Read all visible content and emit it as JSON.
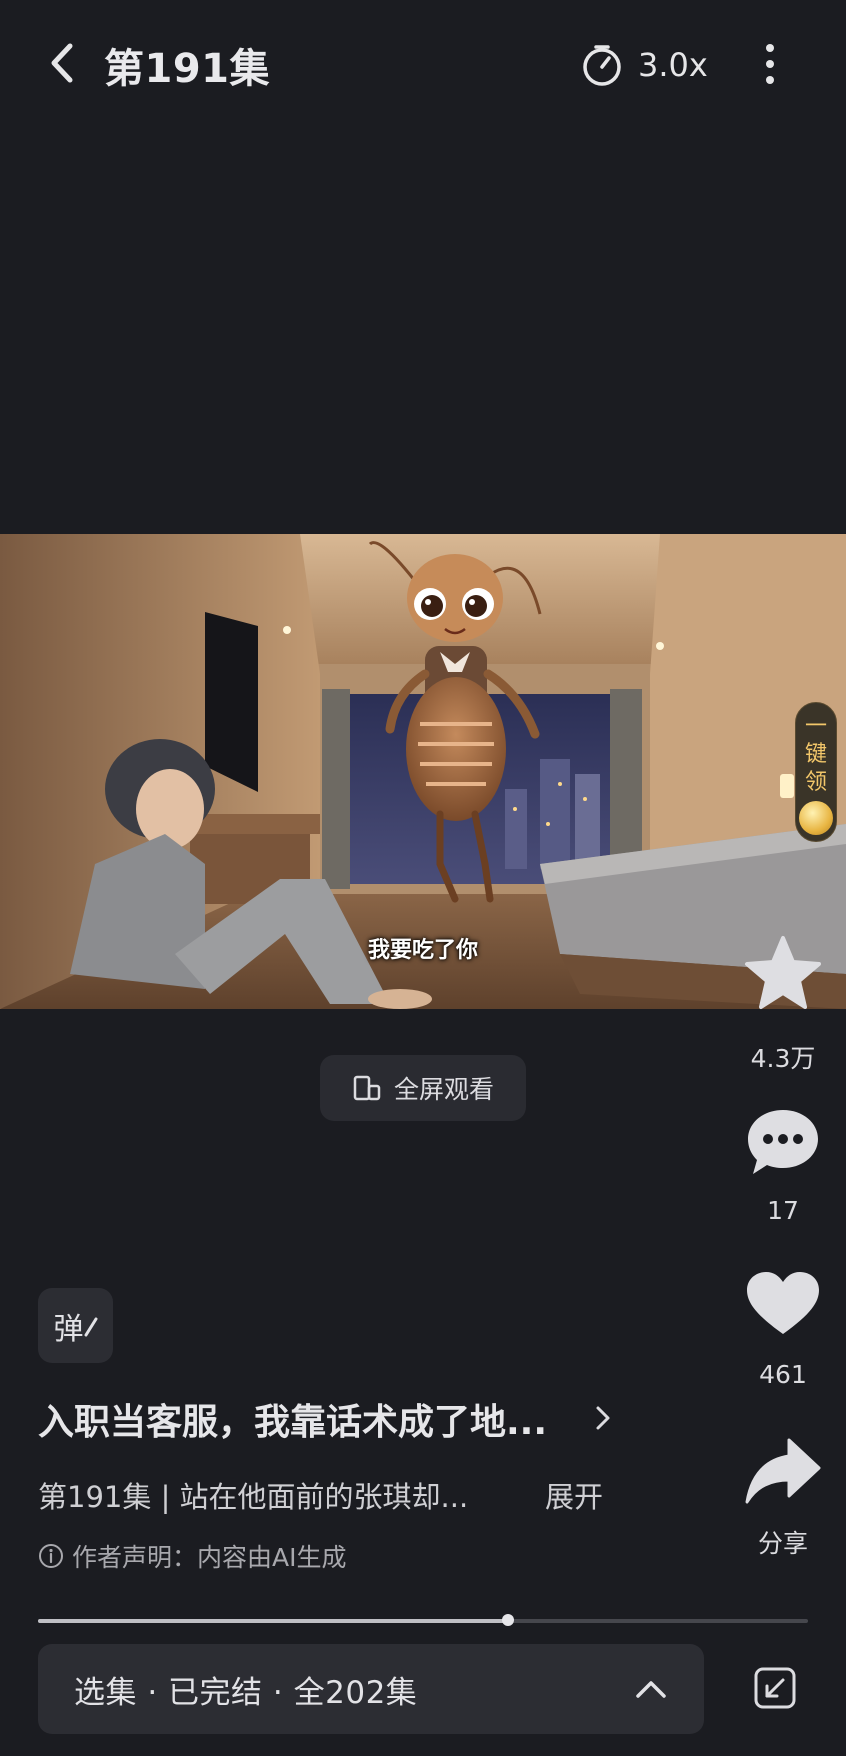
{
  "header": {
    "title": "第191集",
    "speed_label": "3.0x",
    "back_icon": "chevron-left-icon",
    "speed_icon": "timer-icon",
    "more_icon": "more-vertical-icon"
  },
  "video": {
    "subtitle": "我要吃了你"
  },
  "promo": {
    "chars": [
      "一",
      "键",
      "领"
    ],
    "accent": "#f3c76a"
  },
  "fullscreen": {
    "label": "全屏观看"
  },
  "actions": {
    "favorite_count": "4.3万",
    "comment_count": "17",
    "like_count": "461",
    "share_label": "分享"
  },
  "danmaku": {
    "label": "弹"
  },
  "drama": {
    "title": "入职当客服，我靠话术成了地...",
    "description": "第191集 | 站在他面前的张琪却...",
    "expand_label": "展开",
    "notice": "作者声明：内容由AI生成"
  },
  "playback": {
    "progress": 0.61
  },
  "episode_bar": {
    "label": "选集 · 已完结 · 全202集"
  }
}
